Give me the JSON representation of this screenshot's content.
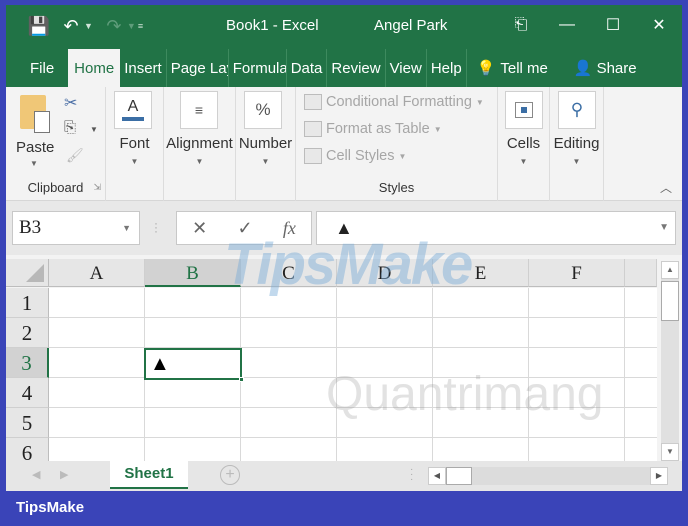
{
  "titlebar": {
    "title": "Book1  -  Excel",
    "user": "Angel Park",
    "qat": {
      "save": "save-icon",
      "undo": "undo-icon",
      "redo": "redo-icon",
      "customize": "customize-icon"
    },
    "controls": {
      "ribbon_display": "ribbon-display-icon",
      "minimize": "—",
      "maximize": "☐",
      "close": "✕"
    }
  },
  "tabs": [
    {
      "label": "File"
    },
    {
      "label": "Home",
      "active": true
    },
    {
      "label": "Insert"
    },
    {
      "label": "Page Lay"
    },
    {
      "label": "Formula"
    },
    {
      "label": "Data"
    },
    {
      "label": "Review"
    },
    {
      "label": "View"
    },
    {
      "label": "Help"
    },
    {
      "label": "Tell me"
    },
    {
      "label": "Share"
    }
  ],
  "ribbon": {
    "clipboard": {
      "paste": "Paste",
      "group": "Clipboard"
    },
    "font": "Font",
    "alignment": "Alignment",
    "number": "Number",
    "number_icon": "%",
    "styles": {
      "conditional": "Conditional Formatting",
      "format_table": "Format as Table",
      "cell_styles": "Cell Styles",
      "group": "Styles"
    },
    "cells": "Cells",
    "editing": "Editing"
  },
  "formula_bar": {
    "name_box": "B3",
    "cancel": "✕",
    "enter": "✓",
    "fx": "fx",
    "value": "▲"
  },
  "grid": {
    "columns": [
      "A",
      "B",
      "C",
      "D",
      "E",
      "F"
    ],
    "rows": [
      "1",
      "2",
      "3",
      "4",
      "5",
      "6"
    ],
    "selected_column": "B",
    "selected_row": "3",
    "active_cell": {
      "ref": "B3",
      "value": "▲"
    }
  },
  "sheets": [
    {
      "label": "Sheet1",
      "active": true
    }
  ],
  "footer": {
    "brand": "TipsMake"
  },
  "watermarks": {
    "top": "TipsMake.com",
    "bottom": "Quantrimang"
  }
}
